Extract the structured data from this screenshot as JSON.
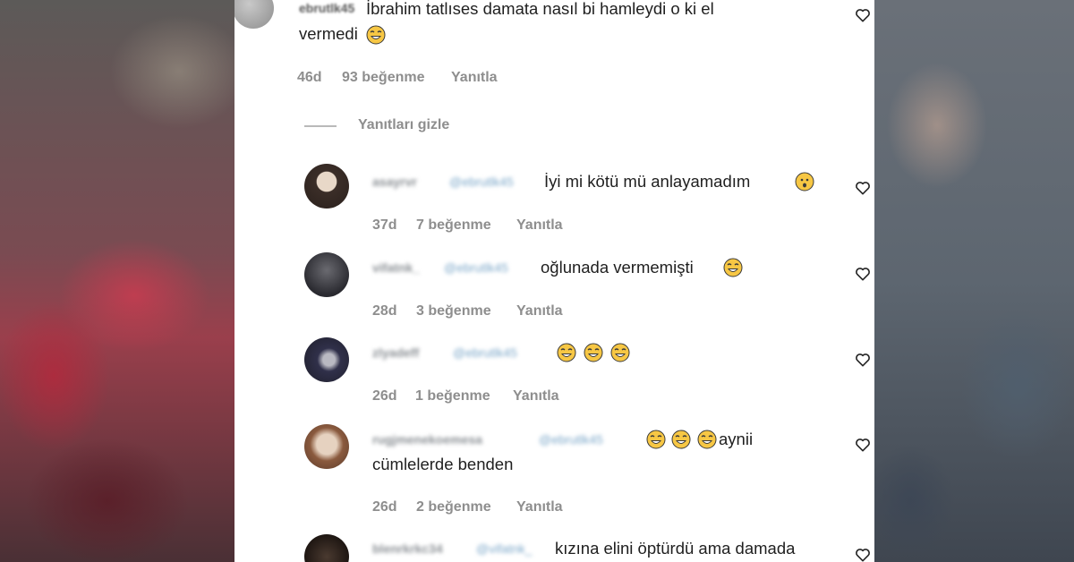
{
  "main_comment": {
    "username": "ebrutlk45",
    "text_line1": "İbrahim tatlıses damata nasıl bi hamleydi o ki el",
    "text_line2": "vermedi",
    "age": "46d",
    "likes": "93 beğenme",
    "reply": "Yanıtla"
  },
  "replies_toggle": "Yanıtları gizle",
  "replies": [
    {
      "username": "asayrvr",
      "mention": "@ebrutlk45",
      "text": "İyi mi kötü mü anlayamadım",
      "age": "37d",
      "likes": "7 beğenme",
      "reply": "Yanıtla"
    },
    {
      "username": "vifatnk_",
      "mention": "@ebrutlk45",
      "text": "oğlunada vermemişti",
      "age": "28d",
      "likes": "3 beğenme",
      "reply": "Yanıtla"
    },
    {
      "username": "zlyadeff",
      "mention": "@ebrutlk45",
      "text": "",
      "age": "26d",
      "likes": "1 beğenme",
      "reply": "Yanıtla"
    },
    {
      "username": "rugjmenekoemesa",
      "mention": "@ebrutlk45",
      "text": "aynii",
      "text_line2": "cümlelerde benden",
      "age": "26d",
      "likes": "2 beğenme",
      "reply": "Yanıtla"
    },
    {
      "username": "blenrkrkc34",
      "mention": "@vifatnk_",
      "text": "kızına elini öptürdü ama damada"
    }
  ],
  "icons": {
    "like": "heart-outline-icon",
    "laugh": "grinning-sweat-emoji-icon",
    "shock": "astonished-face-emoji-icon"
  },
  "colors": {
    "text": "#1f1f1f",
    "meta": "#8e8e8e",
    "mention": "#7aa6c8",
    "emoji_face": "#f7c744"
  }
}
